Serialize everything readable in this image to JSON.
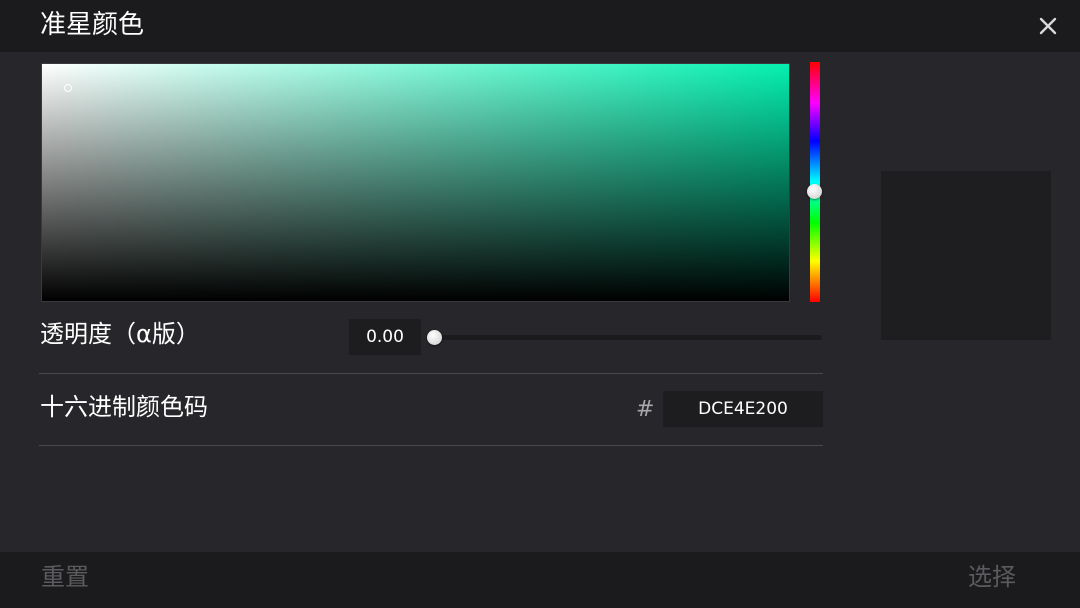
{
  "dialog": {
    "title": "准星颜色"
  },
  "picker": {
    "hue_color": "#04f0b0",
    "preview_color": "#1e1e21"
  },
  "alpha": {
    "label": "透明度（α版）",
    "value": "0.00"
  },
  "hex": {
    "label": "十六进制颜色码",
    "prefix": "#",
    "value": "DCE4E200"
  },
  "footer": {
    "reset_label": "重置",
    "select_label": "选择"
  },
  "icons": {
    "close": "close-icon"
  }
}
